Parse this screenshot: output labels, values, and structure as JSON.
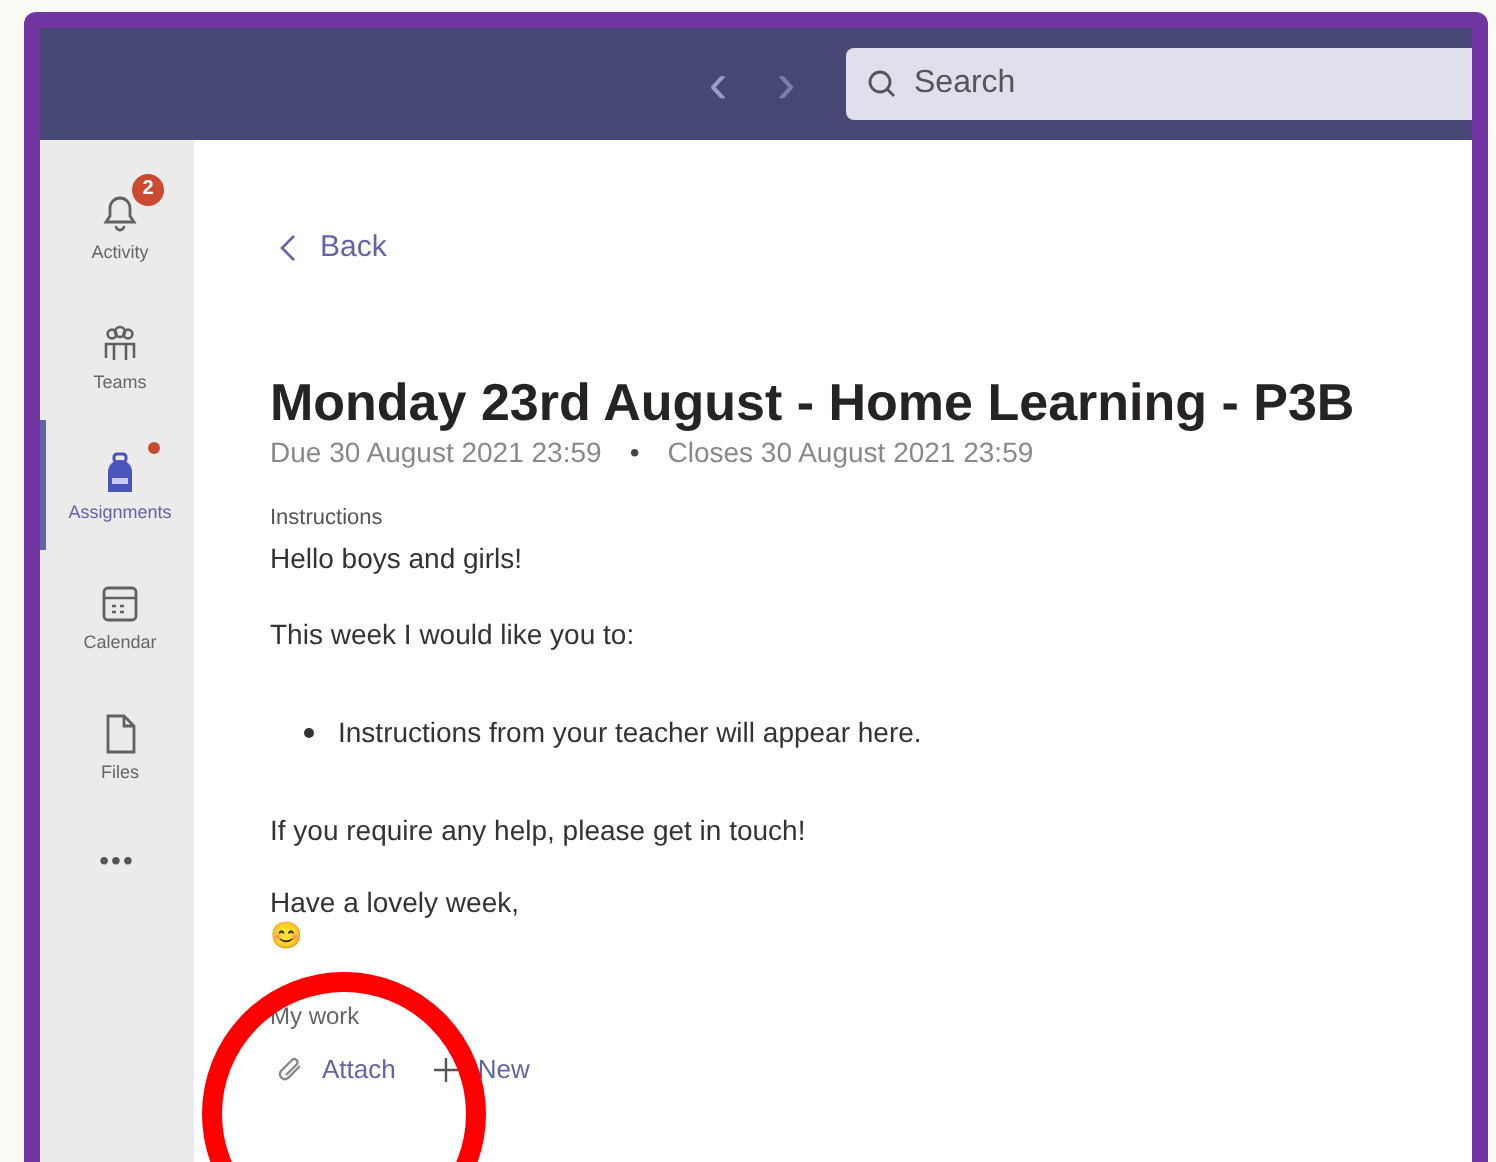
{
  "nav": {
    "back_arrow": "‹",
    "forward_arrow": "›",
    "search": {
      "placeholder": "Search"
    }
  },
  "rail": [
    {
      "kind": "bell",
      "label": "Activity",
      "selected": false,
      "badge": "2",
      "dot": false
    },
    {
      "kind": "teams",
      "label": "Teams",
      "selected": false,
      "dot": false
    },
    {
      "kind": "backpack",
      "label": "Assignments",
      "selected": true,
      "dot": true
    },
    {
      "kind": "calendar",
      "label": "Calendar",
      "selected": false,
      "dot": false
    },
    {
      "kind": "file",
      "label": "Files",
      "selected": false,
      "dot": false
    }
  ],
  "rail_more": "•••",
  "assignment": {
    "back": "Back",
    "title": "Monday 23rd August - Home Learning - P3B",
    "due": "Due 30 August 2021 23:59",
    "separator": "•",
    "closes": "Closes 30 August 2021 23:59",
    "instructions_label": "Instructions",
    "instructions": [
      {
        "kind": "text",
        "text": "Hello boys and girls!"
      },
      {
        "kind": "text",
        "text": "This week I would like you to:"
      },
      {
        "kind": "bullet",
        "text": "Instructions from your teacher will appear here."
      },
      {
        "kind": "text",
        "text": "If you require any help, please get in touch!"
      },
      {
        "kind": "text",
        "text": "Have a lovely week,"
      },
      {
        "kind": "emoji",
        "text": "😊"
      }
    ],
    "my_work_label": "My work",
    "actions": [
      {
        "kind": "attach",
        "label": "Attach"
      },
      {
        "kind": "new",
        "label": "New"
      }
    ]
  },
  "annotation": {
    "kind": "circle",
    "color": "#ff0000"
  }
}
